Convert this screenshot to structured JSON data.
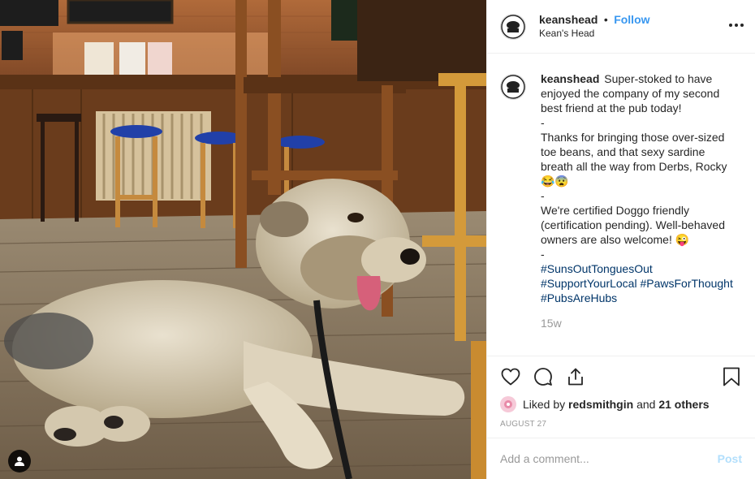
{
  "post": {
    "username": "keanshead",
    "follow_label": "Follow",
    "separator": "•",
    "location": "Kean's Head"
  },
  "caption": {
    "username": "keanshead",
    "lines": [
      "Super-stoked to have enjoyed the company of my second best friend at the pub today!",
      "-",
      "Thanks for bringing those over-sized toe beans, and that sexy sardine breath all the way from Derbs, Rocky 😂😨",
      "-",
      "We're certified Doggo friendly (certification pending). Well-behaved owners are also welcome! 😜",
      "-"
    ],
    "hashtags": [
      "#SunsOutTonguesOut",
      "#SupportYourLocal",
      "#PawsForThought",
      "#PubsAreHubs"
    ],
    "time_ago": "15w"
  },
  "likes": {
    "prefix": "Liked by",
    "liker": "redsmithgin",
    "suffix": "and",
    "others": "21 others"
  },
  "date": "AUGUST 27",
  "comment_box": {
    "placeholder": "Add a comment...",
    "post_label": "Post"
  },
  "icons": {
    "like": "heart-icon",
    "comment": "comment-icon",
    "share": "share-icon",
    "save": "bookmark-icon",
    "more": "more-options-icon",
    "tag": "user-tag-icon"
  },
  "colors": {
    "follow": "#3897f0",
    "hashtag": "#003569",
    "muted": "#999999",
    "post_disabled": "#b2dffc"
  }
}
